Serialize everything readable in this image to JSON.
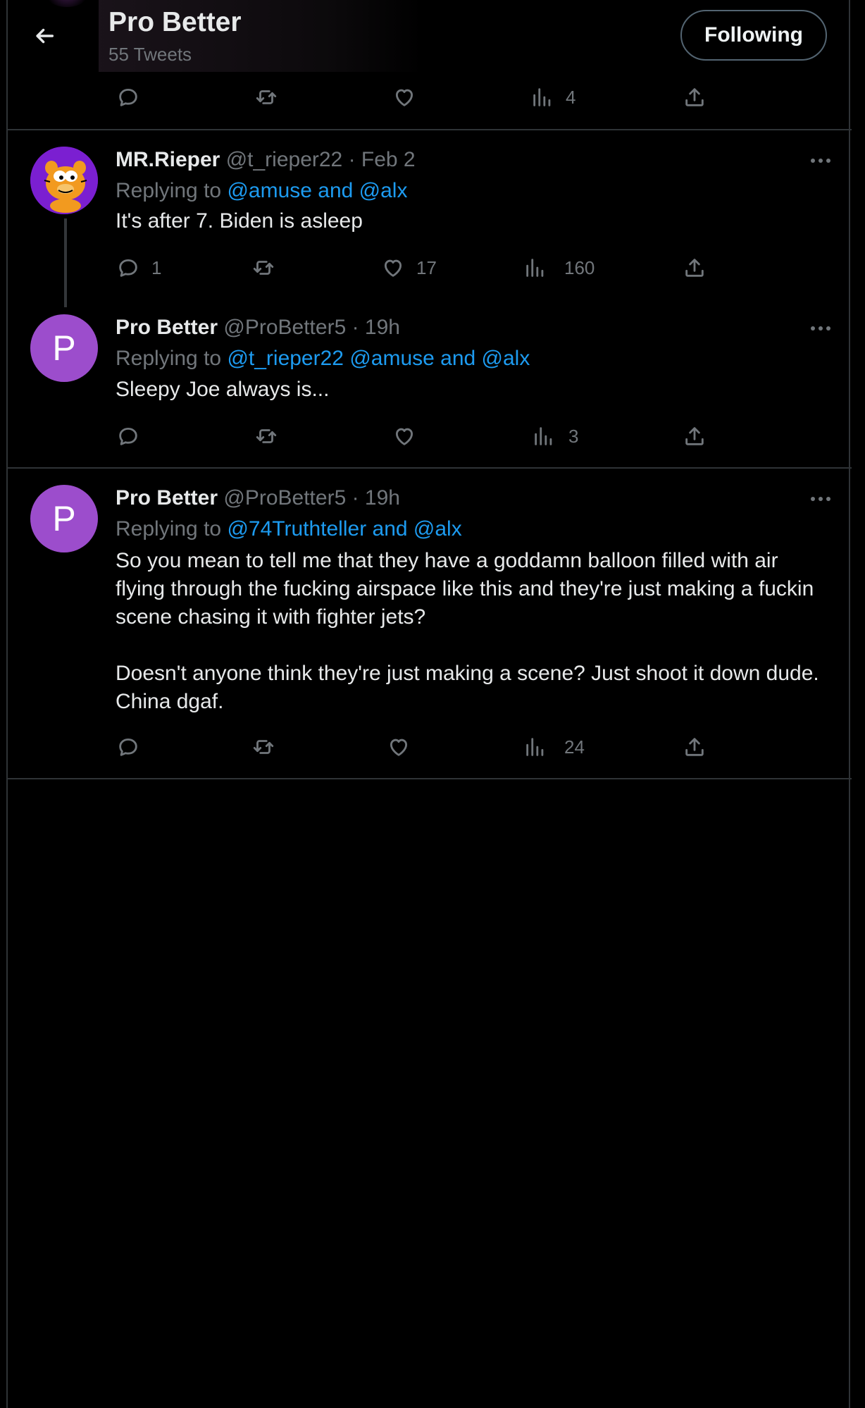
{
  "header": {
    "title": "Pro Better",
    "tweet_count": "55 Tweets",
    "follow_label": "Following"
  },
  "top_actions": {
    "views": "4"
  },
  "tweets": [
    {
      "name": "MR.Rieper",
      "handle_time": "@t_rieper22 · Feb 2",
      "replying_prefix": "Replying to",
      "replying_links": "@amuse and @alx",
      "text": "It's after 7. Biden is asleep",
      "replies": "1",
      "likes": "17",
      "views": "160"
    },
    {
      "name": "Pro Better",
      "handle_time": "@ProBetter5 · 19h",
      "avatar_letter": "P",
      "replying_prefix": "Replying to",
      "replying_links": "@t_rieper22 @amuse and @alx",
      "text": "Sleepy Joe always is...",
      "views": "3"
    },
    {
      "name": "Pro Better",
      "handle_time": "@ProBetter5 · 19h",
      "avatar_letter": "P",
      "replying_prefix": "Replying to",
      "replying_links": "@74Truthteller and @alx",
      "text": "So you mean to tell me that they have a goddamn balloon filled with air flying through the fucking airspace like this and they're just making a fuckin scene chasing it with fighter jets?\n\nDoesn't anyone think they're just making a scene? Just shoot it down dude. China dgaf.",
      "views": "24"
    }
  ],
  "icons": {
    "back": "arrow-left-icon",
    "reply": "reply-icon",
    "retweet": "retweet-icon",
    "like": "heart-icon",
    "views": "views-icon",
    "share": "share-icon",
    "more": "more-icon"
  },
  "colors": {
    "background": "#000000",
    "link": "#1d9bf0",
    "muted": "#71767b",
    "avatar": "#9c4dcc"
  }
}
